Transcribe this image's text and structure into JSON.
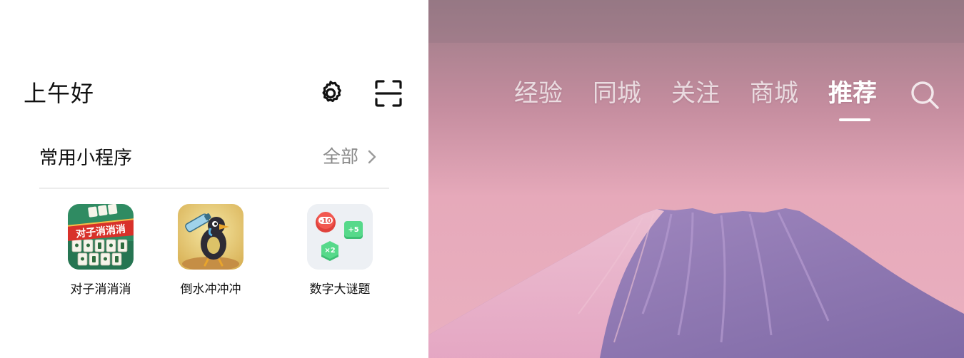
{
  "header": {
    "greeting": "上午好",
    "settings_icon": "gear-icon",
    "scan_icon": "scan-icon"
  },
  "mini_programs": {
    "title": "常用小程序",
    "more_label": "全部",
    "apps": [
      {
        "name": "对子消消消",
        "icon_text": "对子消消消"
      },
      {
        "name": "倒水冲冲冲",
        "icon_text": ""
      },
      {
        "name": "数字大谜题",
        "icon_text": ""
      }
    ],
    "app3_tokens": [
      "-10",
      "+5",
      "×2"
    ]
  },
  "nav": {
    "tabs": [
      {
        "label": "经验",
        "active": false
      },
      {
        "label": "同城",
        "active": false
      },
      {
        "label": "关注",
        "active": false
      },
      {
        "label": "商城",
        "active": false
      },
      {
        "label": "推荐",
        "active": true
      }
    ],
    "search_icon": "search-icon"
  },
  "colors": {
    "text_primary": "#111111",
    "text_secondary": "#8a8a8a",
    "sky_top": "#9a7b86",
    "sky_bottom": "#e8a8b8",
    "mountain": "#8c76b0",
    "tab_active": "#ffffff"
  }
}
